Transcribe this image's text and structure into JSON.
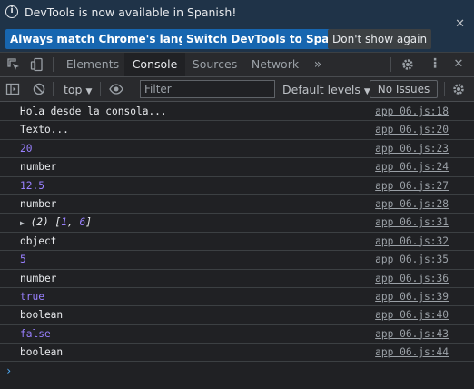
{
  "infobar": {
    "message": "DevTools is now available in Spanish!",
    "buttons": {
      "match": "Always match Chrome's language",
      "switch": "Switch DevTools to Spanish",
      "dismiss": "Don't show again"
    }
  },
  "tabs": [
    "Elements",
    "Console",
    "Sources",
    "Network"
  ],
  "active_tab": "Console",
  "toolbar": {
    "context": "top",
    "filter_placeholder": "Filter",
    "levels": "Default levels",
    "issues": "No Issues"
  },
  "logs": [
    {
      "msg": "Hola desde la consola...",
      "kind": "str",
      "src": "app 06.js:18"
    },
    {
      "msg": "Texto...",
      "kind": "str",
      "src": "app 06.js:20"
    },
    {
      "msg": "20",
      "kind": "num",
      "src": "app 06.js:23"
    },
    {
      "msg": "number",
      "kind": "str",
      "src": "app 06.js:24"
    },
    {
      "msg": "12.5",
      "kind": "num",
      "src": "app 06.js:27"
    },
    {
      "msg": "number",
      "kind": "str",
      "src": "app 06.js:28"
    },
    {
      "msg": "(2) [1, 6]",
      "kind": "array",
      "array": {
        "prefix": "(2) ",
        "values": [
          "1",
          "6"
        ]
      },
      "src": "app 06.js:31"
    },
    {
      "msg": "object",
      "kind": "str",
      "src": "app 06.js:32"
    },
    {
      "msg": "5",
      "kind": "num",
      "src": "app 06.js:35"
    },
    {
      "msg": "number",
      "kind": "str",
      "src": "app 06.js:36"
    },
    {
      "msg": "true",
      "kind": "bool",
      "src": "app 06.js:39"
    },
    {
      "msg": "boolean",
      "kind": "str",
      "src": "app 06.js:40"
    },
    {
      "msg": "false",
      "kind": "bool",
      "src": "app 06.js:43"
    },
    {
      "msg": "boolean",
      "kind": "str",
      "src": "app 06.js:44"
    }
  ],
  "colors": {
    "infobar_bg": "#1f3348",
    "primary_button": "#1766b0",
    "panel_bg": "#202124",
    "number_value": "#9980ff",
    "prompt": "#4fb0ff"
  }
}
